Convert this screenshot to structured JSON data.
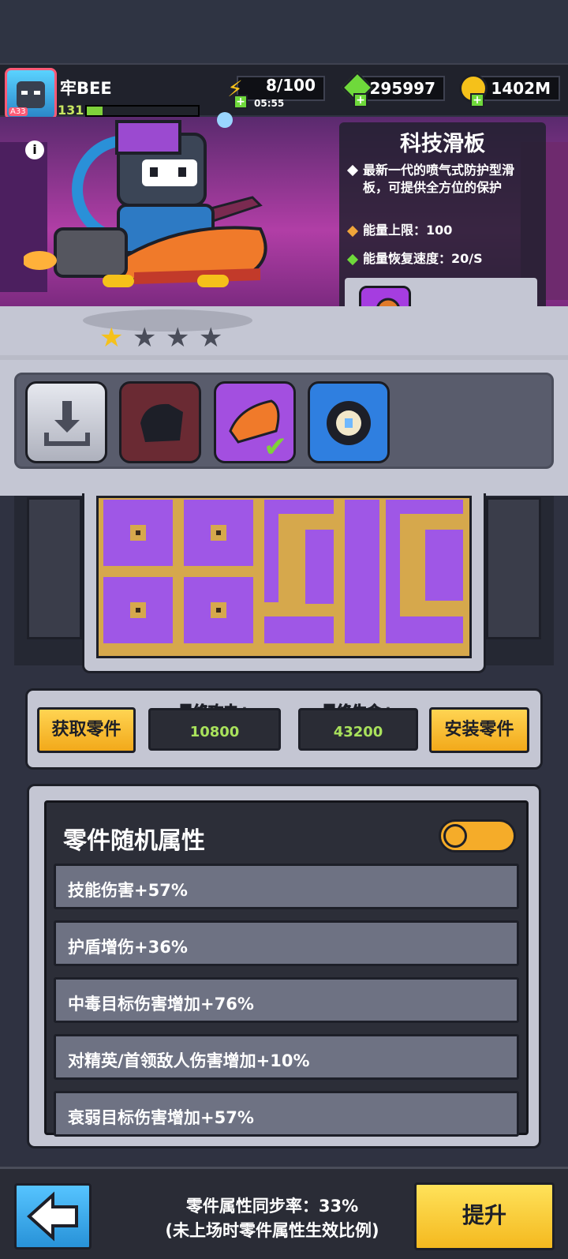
{
  "player": {
    "name": "牢BEE",
    "level": "131",
    "avatar_tag": "A33"
  },
  "resources": {
    "energy": {
      "value": "8/100",
      "timer": "05:55",
      "icon": "lightning-icon",
      "color": "#f5c11a"
    },
    "gems": {
      "value": "295997",
      "icon": "green-gem-icon",
      "color": "#6fd93b"
    },
    "coins": {
      "value": "1402M",
      "icon": "gold-coin-icon",
      "color": "#f5c11a"
    }
  },
  "item": {
    "title": "科技滑板",
    "description": "最新一代的喷气式防护型滑板，可提供全方位的保护",
    "energy_cap": "能量上限：100",
    "energy_regen": "能量恢复速度：20/S",
    "stars_filled": 1,
    "stars_total": 4
  },
  "actions": {
    "get_parts": "获取零件",
    "install_parts": "安装零件",
    "final_attack_label": "最终攻击+",
    "final_attack_value": "10800",
    "final_hp_label": "最终生命+",
    "final_hp_value": "43200"
  },
  "attributes": {
    "title": "零件随机属性",
    "toggle_on": true,
    "rows": [
      "技能伤害+57%",
      "护盾增伤+36%",
      "中毒目标伤害增加+76%",
      "对精英/首领敌人伤害增加+10%",
      "衰弱目标伤害增加+57%"
    ]
  },
  "footer": {
    "sync_rate": "零件属性同步率：33%",
    "sync_note": "(未上场时零件属性生效比例)",
    "upgrade": "提升"
  },
  "colors": {
    "accent_yellow": "#f5ac29",
    "purple": "#9f57e6",
    "attack_green": "#a9e25c"
  }
}
